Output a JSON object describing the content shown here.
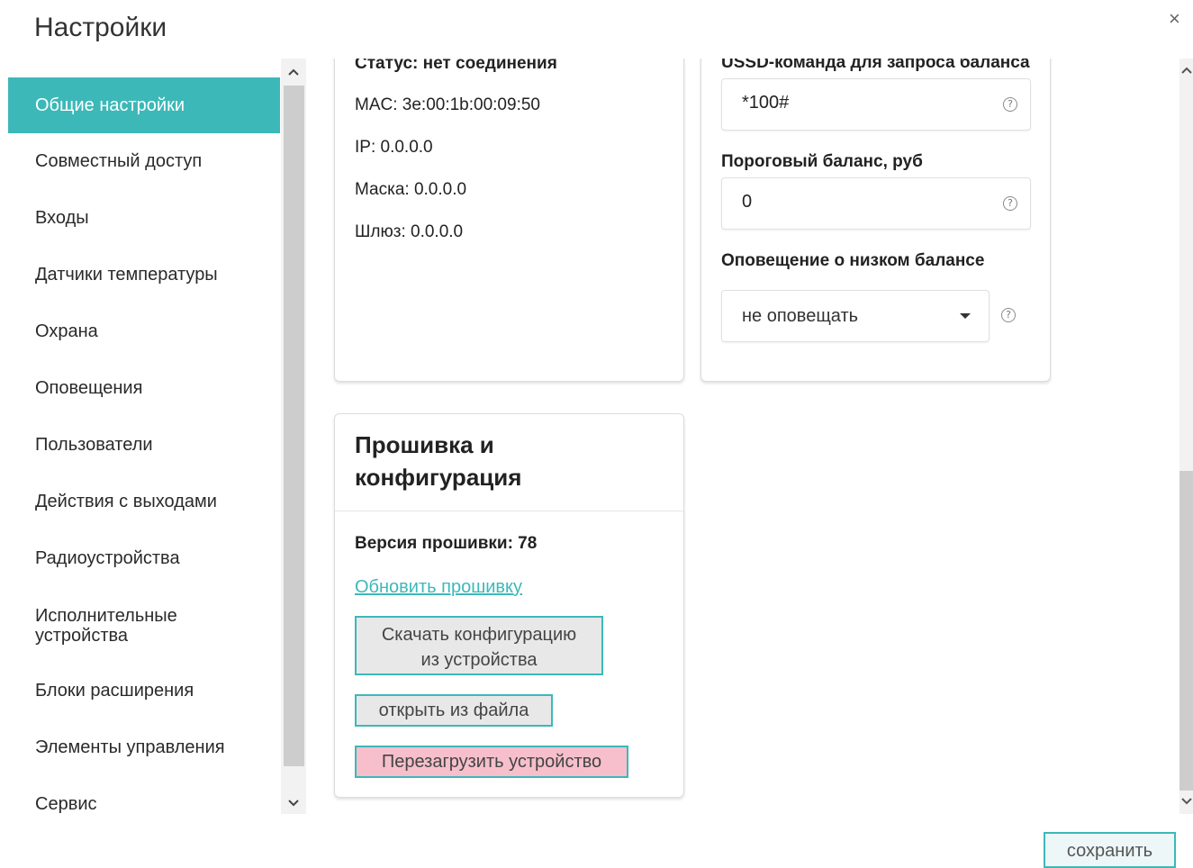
{
  "header": {
    "title": "Настройки",
    "close_label": "×"
  },
  "sidebar": {
    "items": [
      {
        "label": "Общие настройки"
      },
      {
        "label": "Совместный доступ"
      },
      {
        "label": "Входы"
      },
      {
        "label": "Датчики температуры"
      },
      {
        "label": "Охрана"
      },
      {
        "label": "Оповещения"
      },
      {
        "label": "Пользователи"
      },
      {
        "label": "Действия с выходами"
      },
      {
        "label": "Радиоустройства"
      },
      {
        "label": "Исполнительные устройства"
      },
      {
        "label": "Блоки расширения"
      },
      {
        "label": "Элементы управления"
      },
      {
        "label": "Сервис"
      }
    ],
    "active_index": 0
  },
  "network": {
    "status": "Статус: нет соединения",
    "mac": "MAC: 3e:00:1b:00:09:50",
    "ip": "IP: 0.0.0.0",
    "mask": "Маска: 0.0.0.0",
    "gateway": "Шлюз: 0.0.0.0"
  },
  "balance": {
    "ussd_label": "USSD-команда для запроса баланса",
    "ussd_value": "*100#",
    "threshold_label": "Пороговый баланс, руб",
    "threshold_value": "0",
    "notify_label": "Оповещение о низком балансе",
    "notify_value": "не оповещать",
    "help_glyph": "?"
  },
  "firmware": {
    "title_line1": "Прошивка и",
    "title_line2": "конфигурация",
    "version": "Версия прошивки: 78",
    "update_link": "Обновить прошивку",
    "download_line1": "Скачать конфигурацию",
    "download_line2": "из устройства",
    "open_file": "открыть из файла",
    "reboot": "Перезагрузить устройство"
  },
  "footer": {
    "save_label": "сохранить"
  },
  "colors": {
    "accent": "#3db8b8",
    "reboot_bg": "#f6bfcb"
  },
  "icons": {
    "scroll_up": "scroll-up-icon",
    "scroll_down": "scroll-down-icon",
    "help": "help-icon",
    "dropdown": "caret-down-icon",
    "close": "close-icon"
  }
}
